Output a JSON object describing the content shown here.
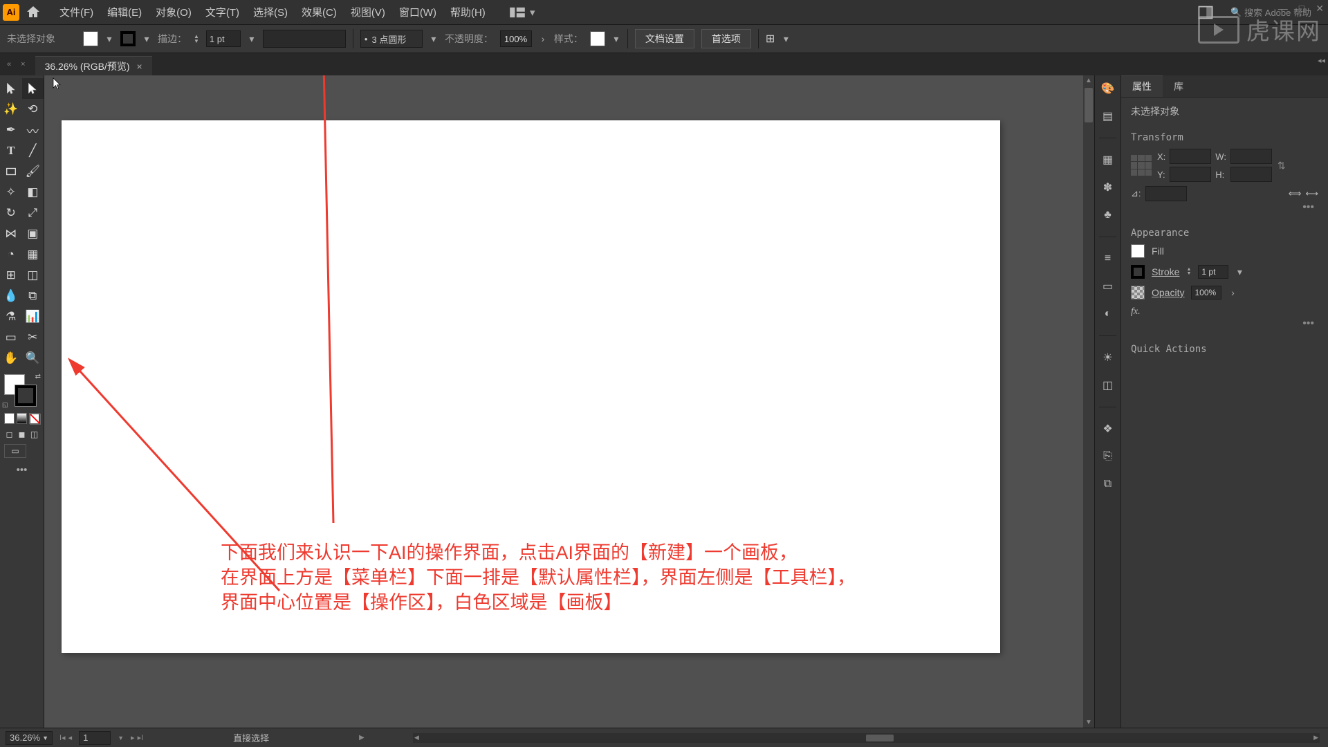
{
  "menubar": {
    "items": [
      "文件(F)",
      "编辑(E)",
      "对象(O)",
      "文字(T)",
      "选择(S)",
      "效果(C)",
      "视图(V)",
      "窗口(W)",
      "帮助(H)"
    ],
    "search_placeholder": "搜索 Adobe 帮助"
  },
  "optionsbar": {
    "no_selection": "未选择对象",
    "stroke_label": "描边：",
    "stroke_value": "1 pt",
    "brush_label": "3 点圆形",
    "opacity_label": "不透明度：",
    "opacity_value": "100%",
    "style_label": "样式：",
    "doc_setup_btn": "文档设置",
    "prefs_btn": "首选项"
  },
  "doc_tab": {
    "title": "36.26% (RGB/预览)",
    "close": "×"
  },
  "annotation": {
    "line1": "下面我们来认识一下AI的操作界面，点击AI界面的【新建】一个画板，",
    "line2": "在界面上方是【菜单栏】下面一排是【默认属性栏】，界面左侧是【工具栏】，",
    "line3": "界面中心位置是【操作区】，白色区域是【画板】"
  },
  "properties": {
    "tab_props": "属性",
    "tab_lib": "库",
    "no_selection": "未选择对象",
    "transform": "Transform",
    "x_label": "X:",
    "y_label": "Y:",
    "w_label": "W:",
    "h_label": "H:",
    "angle_label": "⊿:",
    "appearance": "Appearance",
    "fill": "Fill",
    "stroke": "Stroke",
    "stroke_val": "1 pt",
    "opacity": "Opacity",
    "opacity_val": "100%",
    "fx": "fx.",
    "quick": "Quick Actions"
  },
  "statusbar": {
    "zoom": "36.26%",
    "artboard_num": "1",
    "tool_hint": "直接选择"
  },
  "watermark": "虎课网"
}
